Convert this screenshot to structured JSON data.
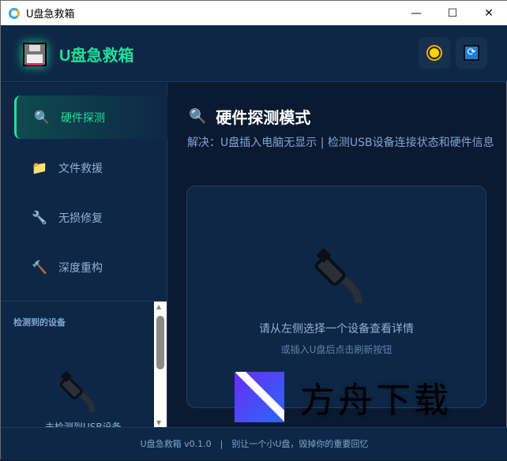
{
  "window": {
    "title": "U盘急救箱",
    "minimize": "—",
    "maximize": "☐",
    "close": "✕"
  },
  "header": {
    "brand": "U盘急救箱",
    "theme_icon": "sun-icon",
    "refresh_icon": "refresh-icon"
  },
  "sidebar": {
    "items": [
      {
        "label": "硬件探测",
        "icon": "magnifier-icon",
        "glyph": "🔍",
        "active": true
      },
      {
        "label": "文件救援",
        "icon": "folder-icon",
        "glyph": "📁",
        "active": false
      },
      {
        "label": "无损修复",
        "icon": "wrench-icon",
        "glyph": "🔧",
        "active": false
      },
      {
        "label": "深度重构",
        "icon": "hammer-icon",
        "glyph": "🔨",
        "active": false
      }
    ],
    "devices_title": "检测到的设备",
    "devices_empty": "未检测到USB设备"
  },
  "main": {
    "title_icon": "🔍",
    "title": "硬件探测模式",
    "subtitle": "解决：U盘插入电脑无显示 | 检测USB设备连接状态和硬件信息",
    "card": {
      "message": "请从左侧选择一个设备查看详情",
      "hint": "或插入U盘后点击刷新按钮"
    }
  },
  "footer": {
    "text": "U盘急救箱 v0.1.0　|　别让一个小U盘，毁掉你的重要回忆"
  },
  "watermark": {
    "text": "方舟下载"
  },
  "colors": {
    "accent": "#1fe09a",
    "background": "#0b1a30",
    "panel": "#0e2746"
  }
}
